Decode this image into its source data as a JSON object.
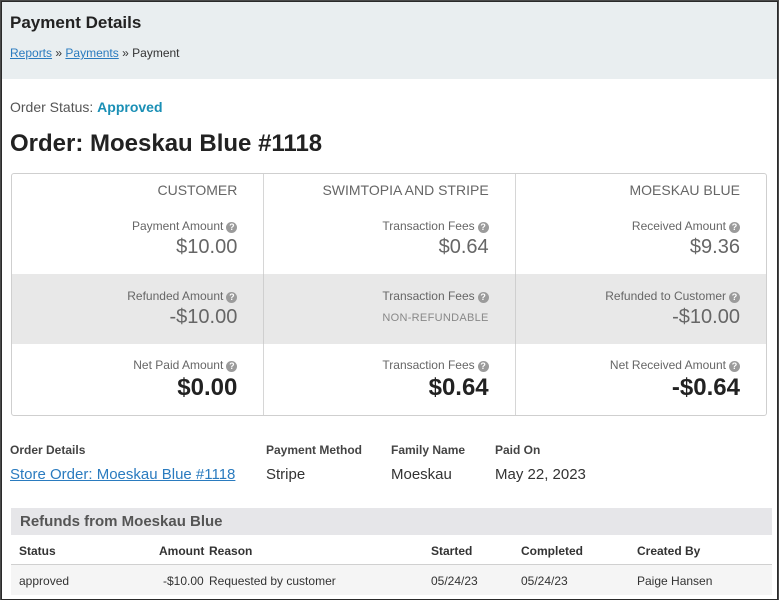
{
  "header": {
    "title": "Payment Details",
    "breadcrumbs": [
      {
        "label": "Reports"
      },
      {
        "label": "Payments"
      },
      {
        "label": "Payment"
      }
    ],
    "sep": "»"
  },
  "order_status": {
    "label": "Order Status:",
    "value": "Approved"
  },
  "order_title": "Order: Moeskau Blue #1118",
  "summary": {
    "columns": [
      "CUSTOMER",
      "SWIMTOPIA AND STRIPE",
      "MOESKAU BLUE"
    ],
    "rows": [
      [
        {
          "label": "Payment Amount",
          "value": "$10.00"
        },
        {
          "label": "Transaction Fees",
          "value": "$0.64"
        },
        {
          "label": "Received Amount",
          "value": "$9.36"
        }
      ],
      [
        {
          "label": "Refunded Amount",
          "value": "-$10.00"
        },
        {
          "label": "Transaction Fees",
          "note": "NON-REFUNDABLE"
        },
        {
          "label": "Refunded to Customer",
          "value": "-$10.00"
        }
      ],
      [
        {
          "label": "Net Paid Amount",
          "value": "$0.00"
        },
        {
          "label": "Transaction Fees",
          "value": "$0.64"
        },
        {
          "label": "Net Received Amount",
          "value": "-$0.64"
        }
      ]
    ],
    "help_glyph": "?"
  },
  "details": {
    "order_details": {
      "label": "Order Details",
      "value": "Store Order: Moeskau Blue #1118"
    },
    "payment_method": {
      "label": "Payment Method",
      "value": "Stripe"
    },
    "family_name": {
      "label": "Family Name",
      "value": "Moeskau"
    },
    "paid_on": {
      "label": "Paid On",
      "value": "May 22, 2023"
    }
  },
  "refunds": {
    "title": "Refunds from Moeskau Blue",
    "columns": [
      "Status",
      "Amount",
      "Reason",
      "Started",
      "Completed",
      "Created By"
    ],
    "rows": [
      {
        "status": "approved",
        "amount": "-$10.00",
        "reason": "Requested by customer",
        "started": "05/24/23",
        "completed": "05/24/23",
        "created_by": "Paige Hansen"
      }
    ]
  },
  "colors": {
    "accent": "#1a8fb5",
    "link": "#2a7bbf",
    "header_bg": "#e9eef0"
  }
}
